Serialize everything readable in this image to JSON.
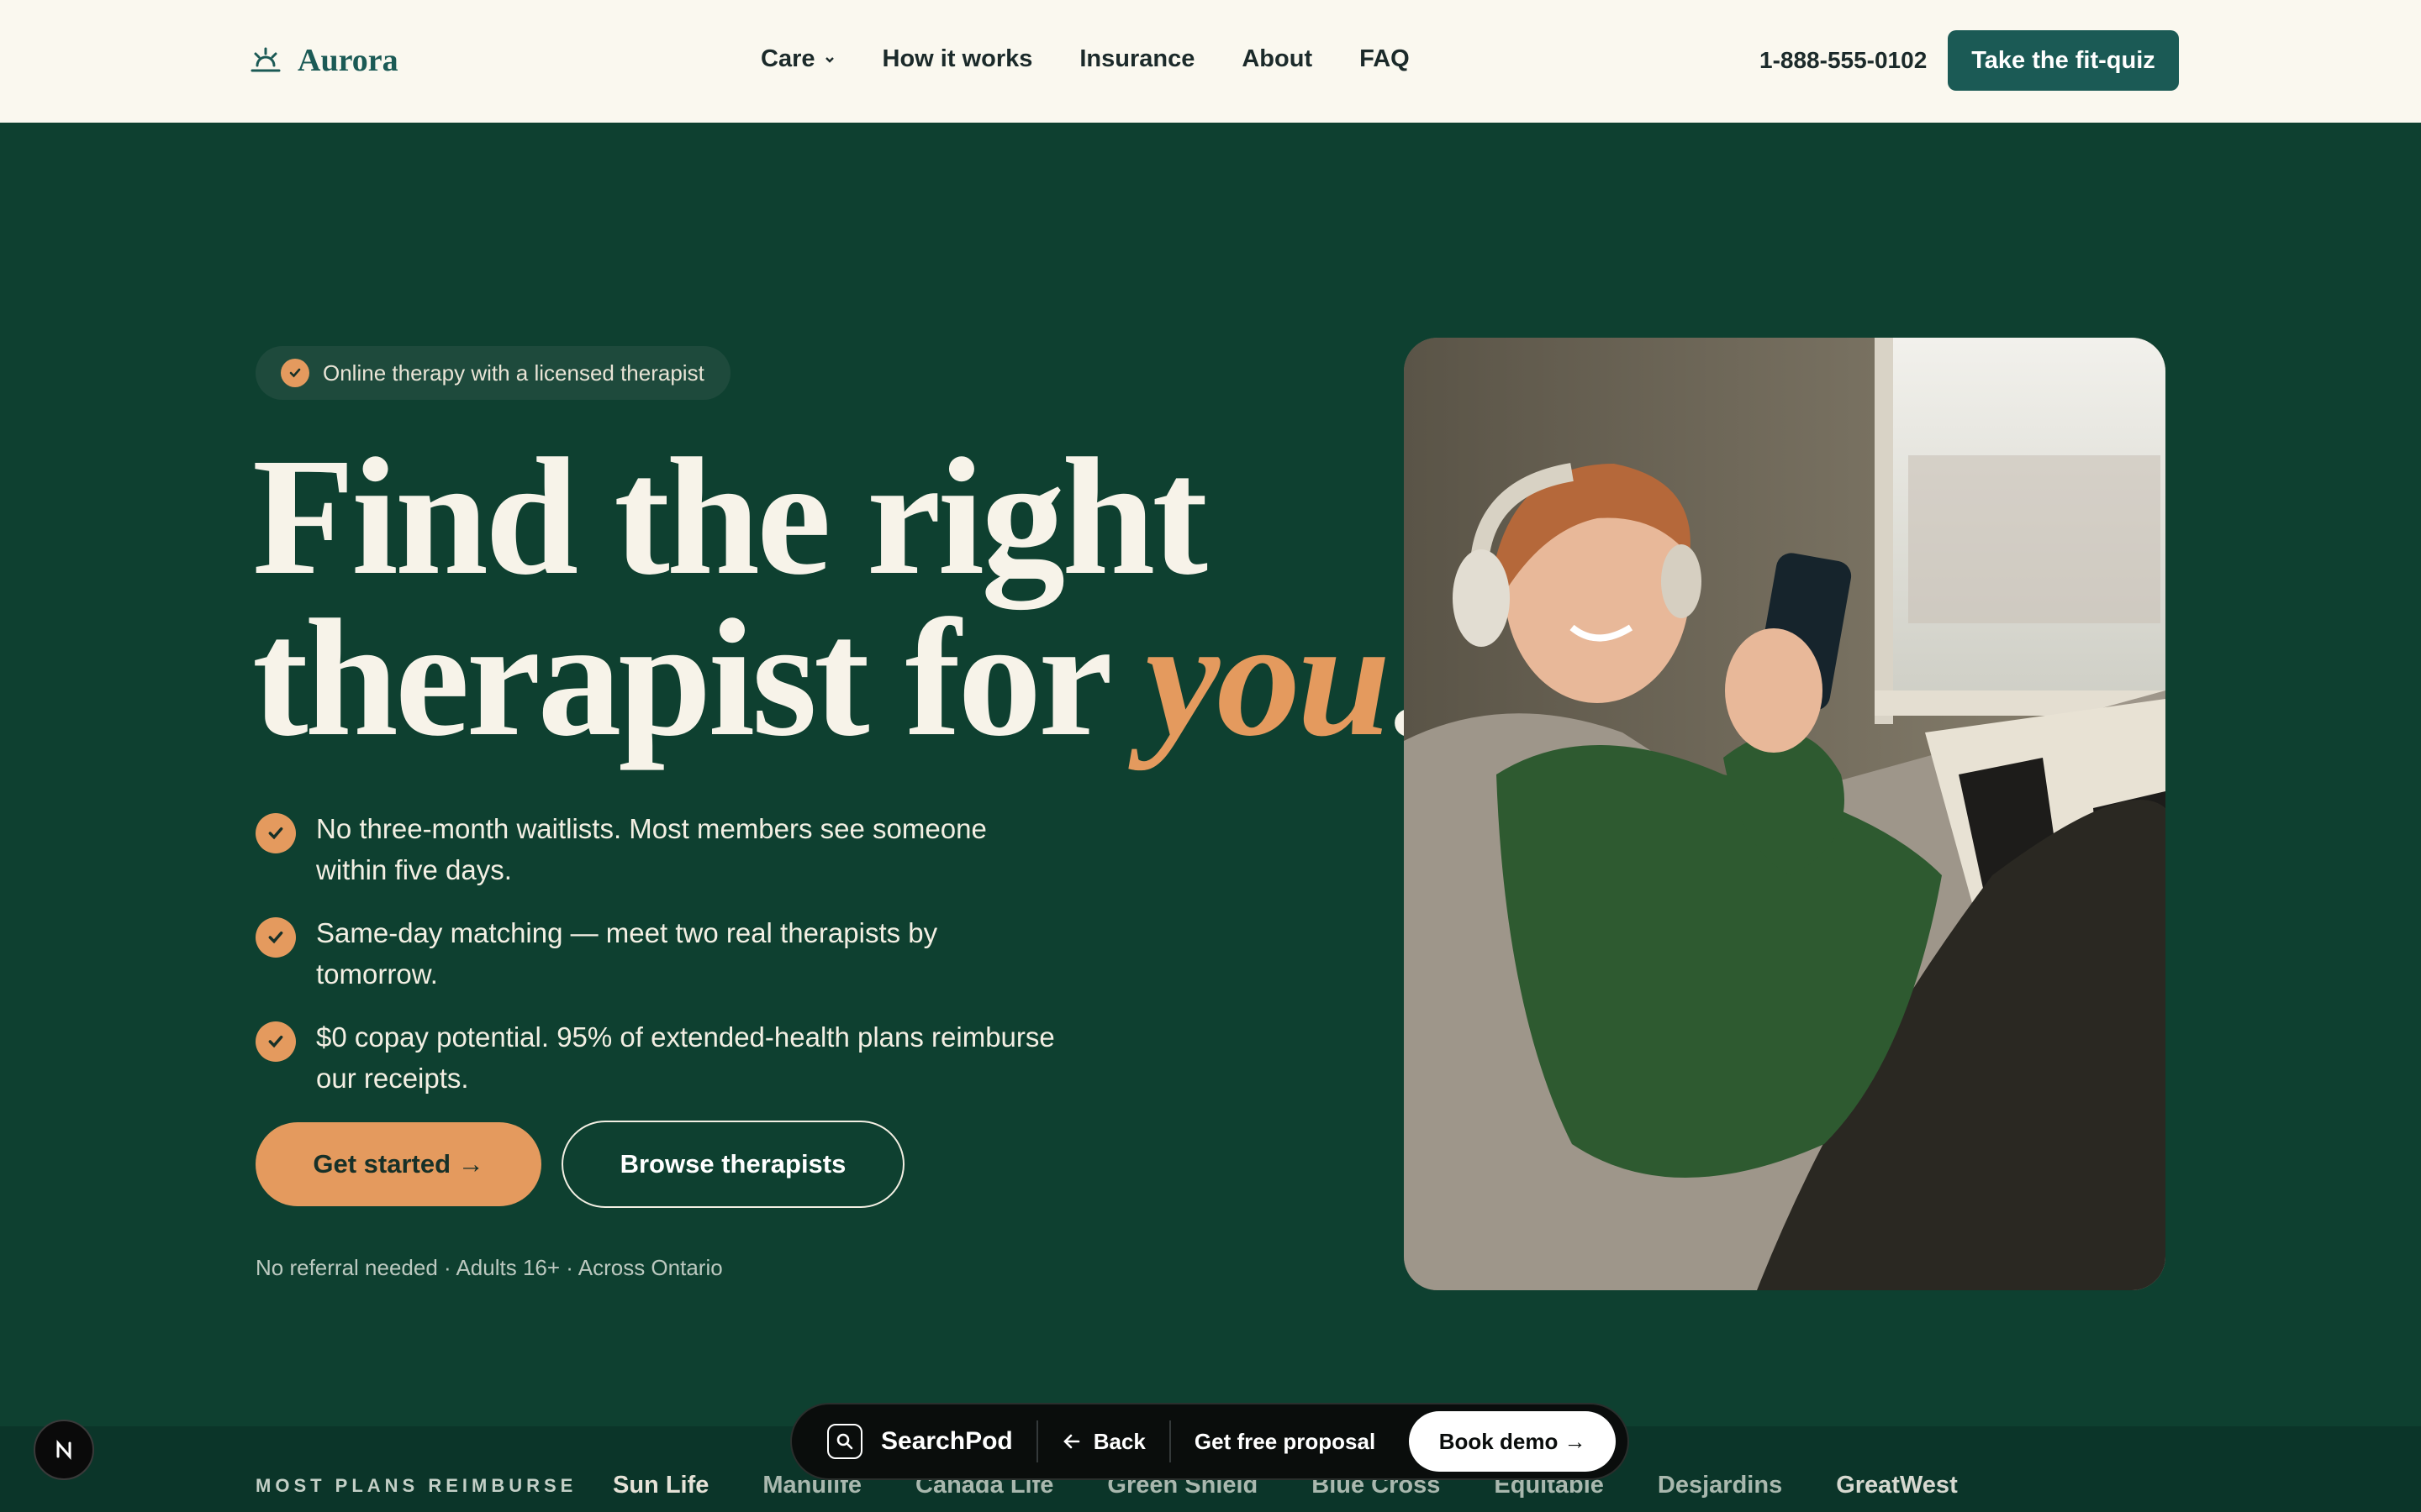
{
  "brand": {
    "name": "Aurora",
    "logo_icon": "sunrise-icon"
  },
  "nav": {
    "links": [
      "Care",
      "How it works",
      "Insurance",
      "About",
      "FAQ"
    ],
    "phone": "1-888-555-0102",
    "cta": "Take the fit-quiz"
  },
  "hero": {
    "pill": "Online therapy with a licensed therapist",
    "headline_line1": "Find the right",
    "headline_line2_start": "therapist for ",
    "headline_accent": "you",
    "headline_end": ".",
    "bullets": [
      "No three-month waitlists. Most members see someone within five days.",
      "Same-day matching — meet two real therapists by tomorrow.",
      "$0 copay potential. 95% of extended-health plans reimburse our receipts."
    ],
    "primary_cta": "Get started →",
    "secondary_cta": "Browse therapists",
    "fine_print": "No referral needed · Adults 16+ · Across Ontario"
  },
  "insurers": {
    "label": "MOST PLANS REIMBURSE",
    "names": [
      "Sun Life",
      "Manulife",
      "Canada Life",
      "Green Shield",
      "Blue Cross",
      "Equitable",
      "Desjardins",
      "GreatWest"
    ]
  },
  "toolbar": {
    "brand": "SearchPod",
    "back": "Back",
    "proposal": "Get free proposal",
    "demo": "Book demo →"
  },
  "colors": {
    "accent": "#e49a5e",
    "brand": "#1b5a55",
    "hero_bg": "#0e4030",
    "nav_bg": "#faf8ef"
  }
}
